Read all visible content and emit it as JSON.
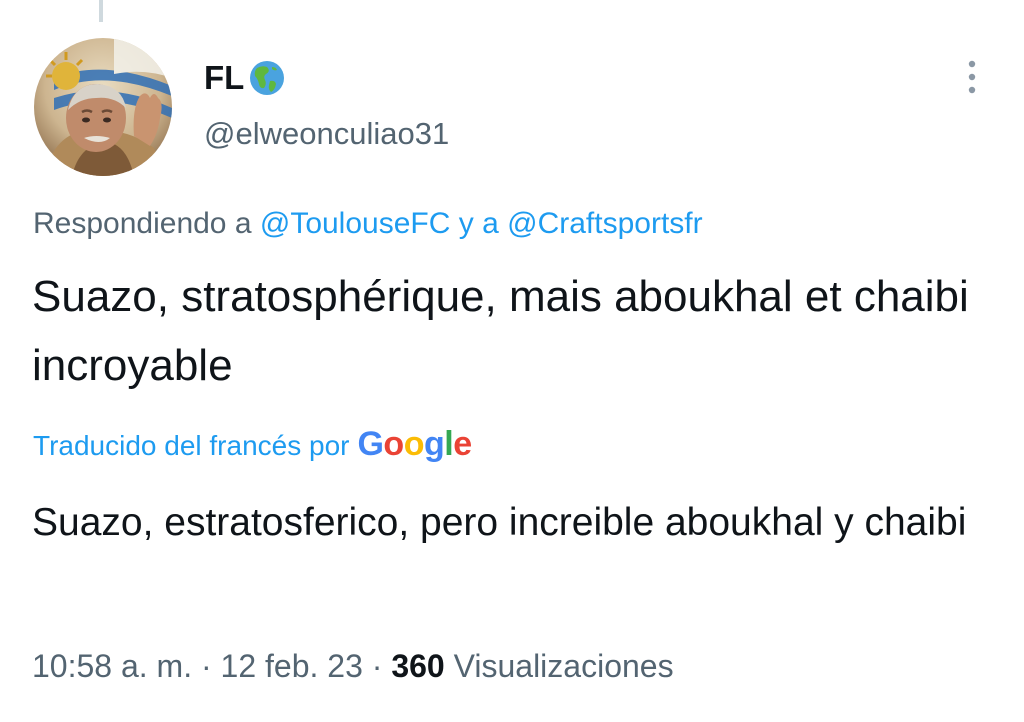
{
  "author": {
    "display_name": "FL",
    "verified_icon": "globe-americas-icon",
    "handle": "@elweonculiao31",
    "avatar": "avatar-man-with-flag"
  },
  "reply_context": {
    "prefix": "Respondiendo a",
    "mention_1": "@ToulouseFC",
    "connector": "y a",
    "mention_2": "@Craftsportsfr"
  },
  "tweet": {
    "text": "Suazo, stratosphérique, mais aboukhal et chaibi incroyable"
  },
  "translation": {
    "label": "Traducido del francés por",
    "provider": "Google",
    "text": "Suazo, estratosferico, pero increible aboukhal y chaibi"
  },
  "meta": {
    "time": "10:58 a. m.",
    "separator_1": "·",
    "date": "12 feb. 23",
    "separator_2": "·",
    "views_count": "360",
    "views_label": "Visualizaciones"
  },
  "colors": {
    "accent": "#1d9bf0",
    "text_primary": "#0f1419",
    "text_secondary": "#536471",
    "thread_line": "#cfd9de"
  }
}
